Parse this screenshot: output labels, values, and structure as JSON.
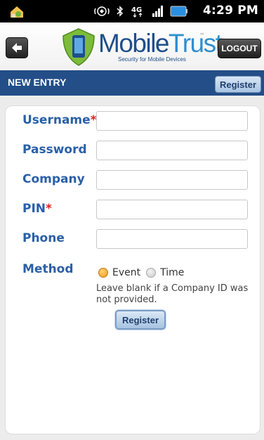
{
  "status_bar": {
    "time": "4:29 PM",
    "network": "4G",
    "icons": [
      "app-notification-icon",
      "headset-icon",
      "bluetooth-icon",
      "network-4g-icon",
      "signal-icon",
      "battery-icon"
    ]
  },
  "header": {
    "logo_mobile": "Mobile",
    "logo_trust": "Trust",
    "logo_tm": "™",
    "logo_tagline": "Security for Mobile Devices",
    "logout_label": "LOGOUT"
  },
  "titlebar": {
    "title": "NEW ENTRY",
    "register_label": "Register"
  },
  "form": {
    "fields": [
      {
        "label": "Username",
        "required": true,
        "value": ""
      },
      {
        "label": "Password",
        "required": false,
        "value": ""
      },
      {
        "label": "Company",
        "required": false,
        "value": ""
      },
      {
        "label": "PIN",
        "required": true,
        "value": ""
      },
      {
        "label": "Phone",
        "required": false,
        "value": ""
      }
    ],
    "required_mark": "*",
    "method": {
      "label": "Method",
      "options": [
        "Event",
        "Time"
      ],
      "selected": "Event"
    },
    "helper_text": "Leave blank if a Company ID was not provided.",
    "register_label": "Register"
  },
  "colors": {
    "accent": "#234e87",
    "label": "#2a5fa8",
    "required": "#e02020",
    "radio_selected": "#f29a1a"
  }
}
